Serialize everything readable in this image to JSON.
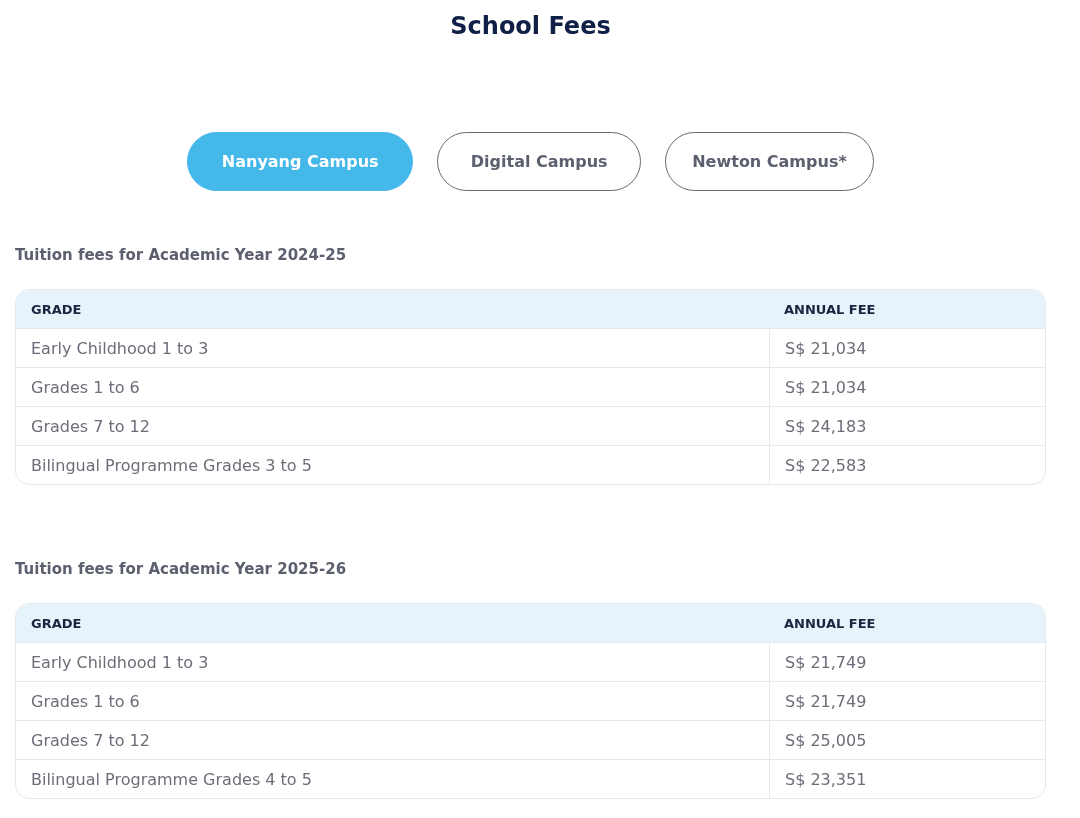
{
  "title": "School Fees",
  "tabs": [
    {
      "label": "Nanyang Campus",
      "selected": true
    },
    {
      "label": "Digital Campus",
      "selected": false
    },
    {
      "label": "Newton Campus*",
      "selected": false
    }
  ],
  "sections": [
    {
      "heading": "Tuition fees for Academic Year 2024-25",
      "columns": [
        "GRADE",
        "ANNUAL FEE"
      ],
      "rows": [
        [
          "Early Childhood 1 to 3",
          "S$ 21,034"
        ],
        [
          "Grades 1 to 6",
          "S$ 21,034"
        ],
        [
          "Grades 7 to 12",
          "S$ 24,183"
        ],
        [
          "Bilingual Programme Grades 3 to 5",
          "S$ 22,583"
        ]
      ]
    },
    {
      "heading": "Tuition fees for Academic Year 2025-26",
      "columns": [
        "GRADE",
        "ANNUAL FEE"
      ],
      "rows": [
        [
          "Early Childhood 1 to 3",
          "S$ 21,749"
        ],
        [
          "Grades 1 to 6",
          "S$ 21,749"
        ],
        [
          "Grades 7 to 12",
          "S$ 25,005"
        ],
        [
          "Bilingual Programme Grades 4 to 5",
          "S$ 23,351"
        ]
      ]
    }
  ]
}
